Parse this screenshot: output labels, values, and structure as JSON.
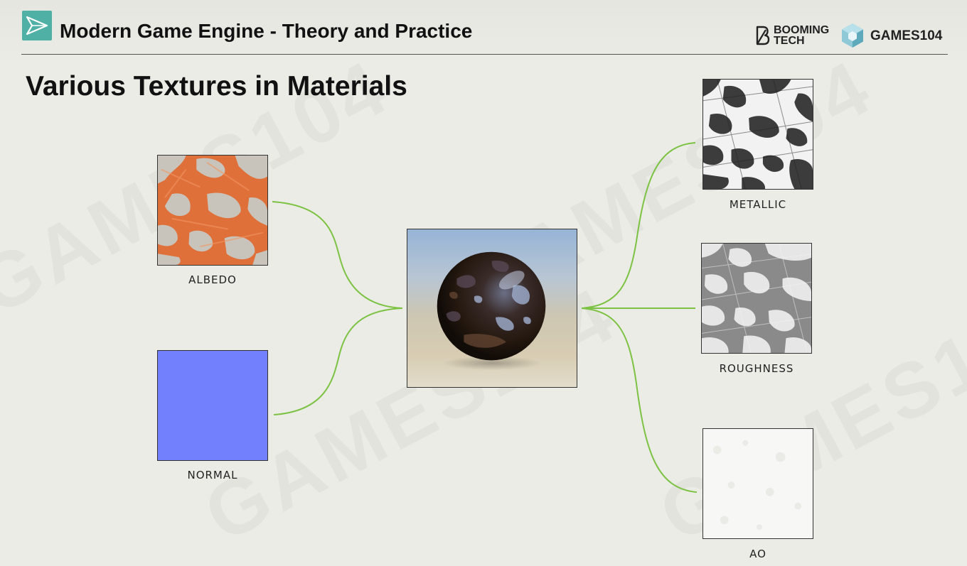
{
  "header": {
    "title": "Modern Game Engine - Theory and Practice",
    "booming_line1": "BOOMING",
    "booming_line2": "TECH",
    "games_brand": "GAMES104"
  },
  "slide": {
    "title": "Various Textures in Materials"
  },
  "textures": {
    "albedo": "ALBEDO",
    "normal": "NORMAL",
    "metallic": "METALLIC",
    "roughness": "ROUGHNESS",
    "ao": "AO"
  },
  "colors": {
    "accent_logo": "#4fb0a6",
    "connector_green": "#7cc243",
    "albedo_orange": "#e0703a",
    "normal_blue": "#7380fd"
  },
  "icons": {
    "header_logo": "play-triangle-icon",
    "booming_logo": "b-logo-icon",
    "games_logo": "hexagon-cube-icon"
  }
}
